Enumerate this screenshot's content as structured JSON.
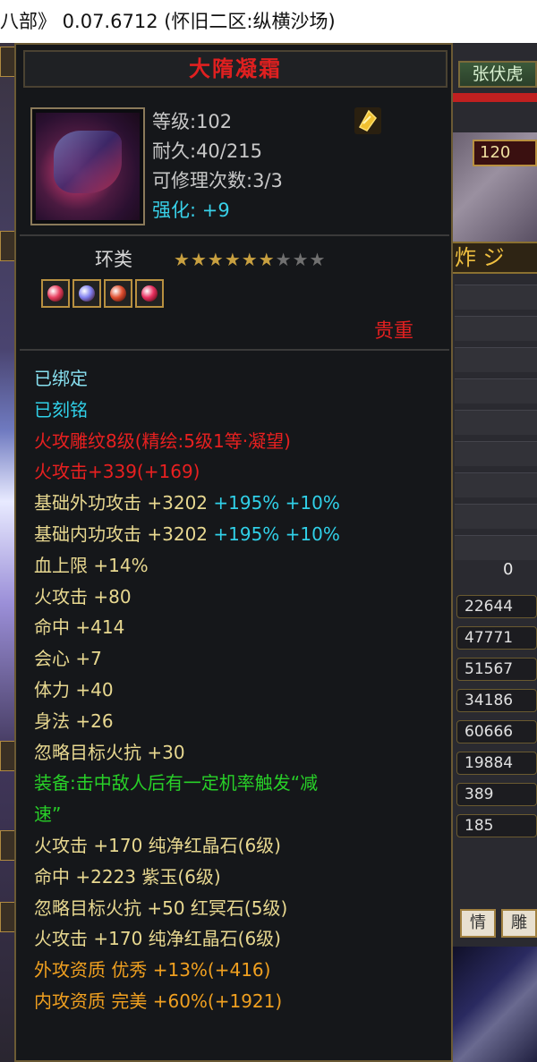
{
  "window": {
    "title": "八部》 0.07.6712 (怀旧二区:纵横沙场)"
  },
  "item": {
    "name": "大隋凝霜",
    "level": "等级:102",
    "durability": "耐久:40/215",
    "repair": "可修理次数:3/3",
    "enhance_label": "强化:",
    "enhance_value": "+9",
    "type": "环类",
    "stars_total": 9,
    "stars_filled": 6,
    "rarity": "贵重",
    "gem_colors": [
      "#e84060",
      "#8080f0",
      "#e05030",
      "#e83060"
    ]
  },
  "properties": {
    "bound": "已绑定",
    "engraved": "已刻铭",
    "carving": "火攻雕纹8级(精绘:5级1等·凝望)",
    "fire_attack_line": "火攻击+339(+169)",
    "base_ext_label": "基础外功攻击 +3202 ",
    "base_ext_pct": "+195% +10%",
    "base_int_label": "基础内功攻击 +3202 ",
    "base_int_pct": "+195% +10%",
    "hp": "血上限 +14%",
    "fire_attack": "火攻击 +80",
    "hit": "命中 +414",
    "crit": "会心 +7",
    "stamina": "体力 +40",
    "agility": "身法 +26",
    "ignore_fire": "忽略目标火抗 +30",
    "equip_effect_1": "装备:击中敌人后有一定机率触发“减",
    "equip_effect_2": "速”",
    "gem1": "火攻击 +170 纯净红晶石(6级)",
    "gem2": "命中 +2223 紫玉(6级)",
    "gem3": "忽略目标火抗 +50 红冥石(5级)",
    "gem4": "火攻击 +170 纯净红晶石(6级)",
    "ext_quality": "外攻资质  优秀 +13%(+416)",
    "int_quality": "内攻资质  完美 +60%(+1921)"
  },
  "right_panel": {
    "target_name": "张伏虎",
    "badge_value": "120",
    "banner": "炸 ジ",
    "zero": "0",
    "stats": [
      "22644",
      "47771",
      "51567",
      "34186",
      "60666",
      "19884",
      "389",
      "185"
    ],
    "btn1": "情",
    "btn2": "雕"
  }
}
